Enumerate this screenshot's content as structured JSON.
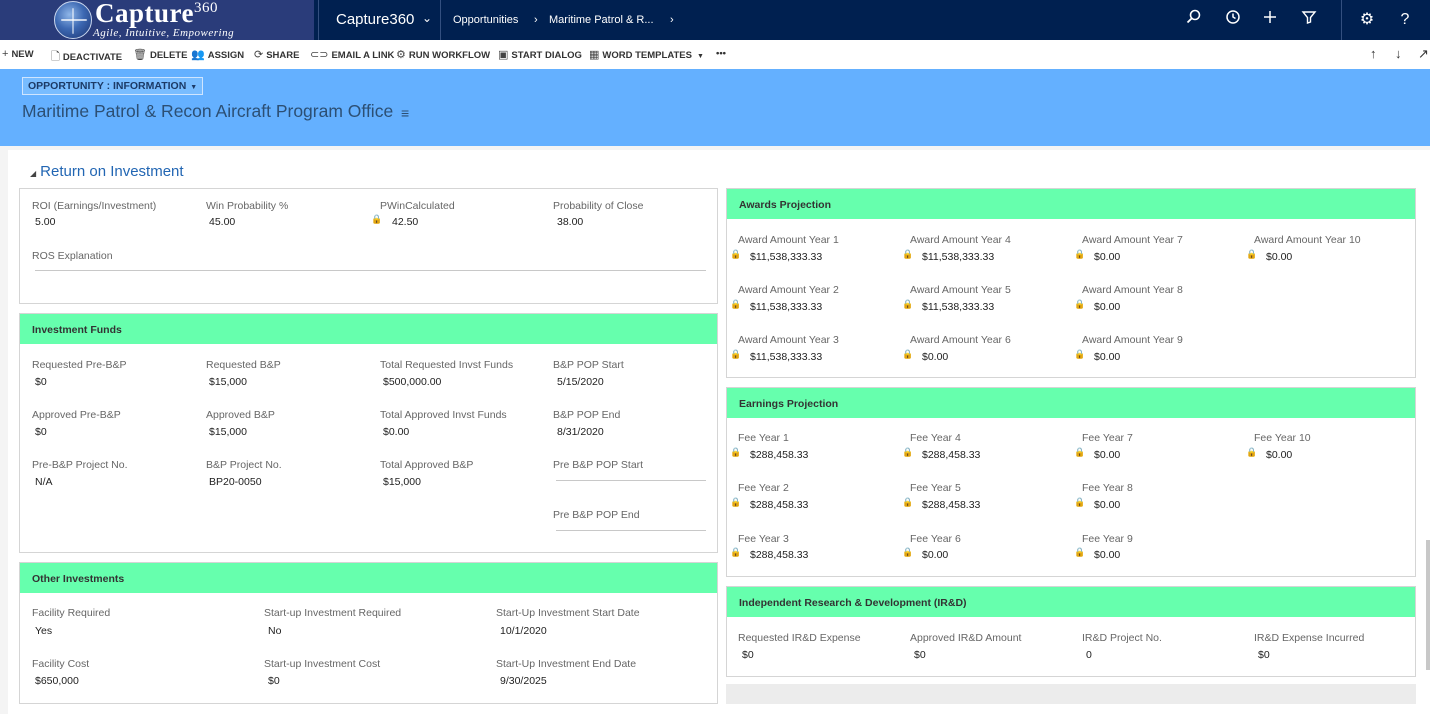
{
  "app": {
    "logo_name": "Capture",
    "logo_sup": "360",
    "logo_tagline": "Agile, Intuitive, Empowering",
    "app_name": "Capture360",
    "breadcrumb": [
      "Opportunities",
      "Maritime Patrol & R..."
    ]
  },
  "commands": {
    "new": "NEW",
    "deactivate": "DEACTIVATE",
    "delete": "DELETE",
    "assign": "ASSIGN",
    "share": "SHARE",
    "email_link": "EMAIL A LINK",
    "run_workflow": "RUN WORKFLOW",
    "start_dialog": "START DIALOG",
    "word_templates": "WORD TEMPLATES",
    "more": "•••"
  },
  "header": {
    "form_selector": "OPPORTUNITY : INFORMATION",
    "record_title": "Maritime Patrol & Recon Aircraft Program Office"
  },
  "section": {
    "title": "Return on Investment"
  },
  "roi": {
    "roi_label": "ROI (Earnings/Investment)",
    "roi_value": "5.00",
    "win_label": "Win Probability %",
    "win_value": "45.00",
    "pwin_label": "PWinCalculated",
    "pwin_value": "42.50",
    "poc_label": "Probability of Close",
    "poc_value": "38.00",
    "ros_label": "ROS Explanation"
  },
  "investment_funds": {
    "title": "Investment Funds",
    "req_pre_label": "Requested Pre-B&P",
    "req_pre_value": "$0",
    "req_bp_label": "Requested B&P",
    "req_bp_value": "$15,000",
    "total_req_label": "Total Requested Invst Funds",
    "total_req_value": "$500,000.00",
    "bp_pop_start_label": "B&P POP Start",
    "bp_pop_start_value": "5/15/2020",
    "app_pre_label": "Approved Pre-B&P",
    "app_pre_value": "$0",
    "app_bp_label": "Approved B&P",
    "app_bp_value": "$15,000",
    "total_app_label": "Total Approved Invst Funds",
    "total_app_value": "$0.00",
    "bp_pop_end_label": "B&P POP End",
    "bp_pop_end_value": "8/31/2020",
    "pre_proj_label": "Pre-B&P Project No.",
    "pre_proj_value": "N/A",
    "bp_proj_label": "B&P Project No.",
    "bp_proj_value": "BP20-0050",
    "total_app_bp_label": "Total Approved B&P",
    "total_app_bp_value": "$15,000",
    "pre_pop_start_label": "Pre B&P POP Start",
    "pre_pop_end_label": "Pre B&P POP End"
  },
  "other_investments": {
    "title": "Other Investments",
    "facility_req_label": "Facility Required",
    "facility_req_value": "Yes",
    "startup_req_label": "Start-up Investment Required",
    "startup_req_value": "No",
    "startup_start_label": "Start-Up Investment Start Date",
    "startup_start_value": "10/1/2020",
    "facility_cost_label": "Facility Cost",
    "facility_cost_value": "$650,000",
    "startup_cost_label": "Start-up Investment Cost",
    "startup_cost_value": "$0",
    "startup_end_label": "Start-Up Investment End Date",
    "startup_end_value": "9/30/2025"
  },
  "awards": {
    "title": "Awards Projection",
    "items": [
      {
        "label": "Award Amount Year 1",
        "value": "$11,538,333.33"
      },
      {
        "label": "Award Amount Year 2",
        "value": "$11,538,333.33"
      },
      {
        "label": "Award Amount Year 3",
        "value": "$11,538,333.33"
      },
      {
        "label": "Award Amount Year 4",
        "value": "$11,538,333.33"
      },
      {
        "label": "Award Amount Year 5",
        "value": "$11,538,333.33"
      },
      {
        "label": "Award Amount Year 6",
        "value": "$0.00"
      },
      {
        "label": "Award Amount Year 7",
        "value": "$0.00"
      },
      {
        "label": "Award Amount Year 8",
        "value": "$0.00"
      },
      {
        "label": "Award Amount Year 9",
        "value": "$0.00"
      },
      {
        "label": "Award Amount Year 10",
        "value": "$0.00"
      }
    ]
  },
  "earnings": {
    "title": "Earnings Projection",
    "items": [
      {
        "label": "Fee Year 1",
        "value": "$288,458.33"
      },
      {
        "label": "Fee Year 2",
        "value": "$288,458.33"
      },
      {
        "label": "Fee Year 3",
        "value": "$288,458.33"
      },
      {
        "label": "Fee Year 4",
        "value": "$288,458.33"
      },
      {
        "label": "Fee Year 5",
        "value": "$288,458.33"
      },
      {
        "label": "Fee Year 6",
        "value": "$0.00"
      },
      {
        "label": "Fee Year 7",
        "value": "$0.00"
      },
      {
        "label": "Fee Year 8",
        "value": "$0.00"
      },
      {
        "label": "Fee Year 9",
        "value": "$0.00"
      },
      {
        "label": "Fee Year 10",
        "value": "$0.00"
      }
    ]
  },
  "ird": {
    "title": "Independent Research & Development (IR&D)",
    "req_label": "Requested IR&D Expense",
    "req_value": "$0",
    "app_label": "Approved IR&D Amount",
    "app_value": "$0",
    "proj_label": "IR&D Project No.",
    "proj_value": "0",
    "incurred_label": "IR&D Expense Incurred",
    "incurred_value": "$0"
  }
}
